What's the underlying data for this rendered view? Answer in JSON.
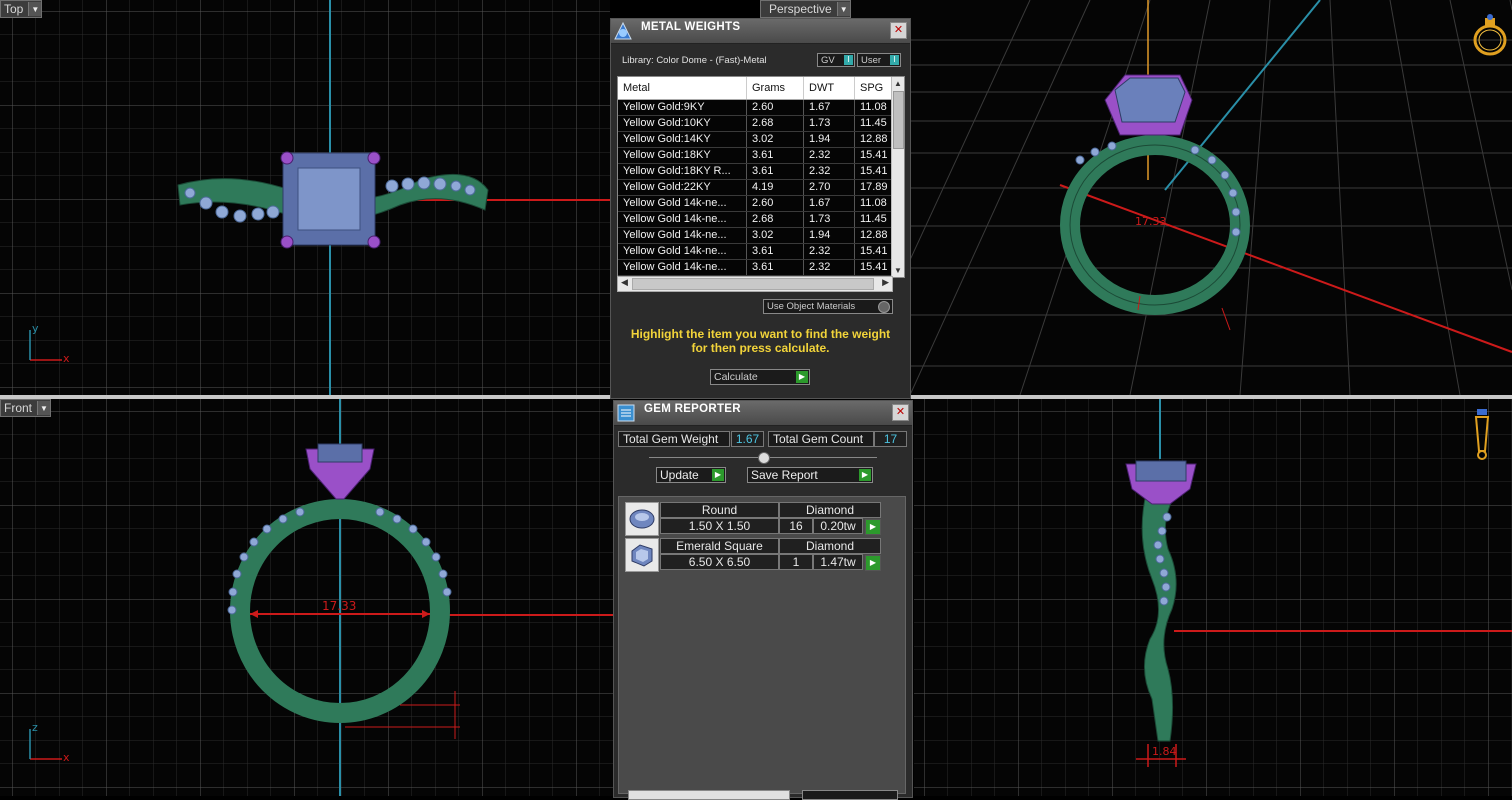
{
  "viewports": {
    "top": {
      "label": "Top",
      "axis_h": "x",
      "axis_v": "y"
    },
    "perspective": {
      "label": "Perspective"
    },
    "front": {
      "label": "Front",
      "axis_h": "x",
      "axis_v": "z",
      "dimension": "17.33"
    },
    "right": {
      "label": "",
      "dimension": "1.84"
    }
  },
  "metal_weights": {
    "title": "METAL WEIGHTS",
    "library": "Library: Color Dome - (Fast)-Metal",
    "toggle_gv": "GV",
    "toggle_user": "User",
    "columns": [
      "Metal",
      "Grams",
      "DWT",
      "SPG"
    ],
    "rows": [
      [
        "Yellow Gold:9KY",
        "2.60",
        "1.67",
        "11.08"
      ],
      [
        "Yellow Gold:10KY",
        "2.68",
        "1.73",
        "11.45"
      ],
      [
        "Yellow Gold:14KY",
        "3.02",
        "1.94",
        "12.88"
      ],
      [
        "Yellow Gold:18KY",
        "3.61",
        "2.32",
        "15.41"
      ],
      [
        "Yellow Gold:18KY R...",
        "3.61",
        "2.32",
        "15.41"
      ],
      [
        "Yellow Gold:22KY",
        "4.19",
        "2.70",
        "17.89"
      ],
      [
        "Yellow Gold 14k-ne...",
        "2.60",
        "1.67",
        "11.08"
      ],
      [
        "Yellow Gold 14k-ne...",
        "2.68",
        "1.73",
        "11.45"
      ],
      [
        "Yellow Gold 14k-ne...",
        "3.02",
        "1.94",
        "12.88"
      ],
      [
        "Yellow Gold 14k-ne...",
        "3.61",
        "2.32",
        "15.41"
      ],
      [
        "Yellow Gold 14k-ne...",
        "3.61",
        "2.32",
        "15.41"
      ]
    ],
    "use_object_materials": "Use Object Materials",
    "hint_line1": "Highlight the item you want to find the weight",
    "hint_line2": "for then press calculate.",
    "calculate": "Calculate"
  },
  "gem_reporter": {
    "title": "GEM REPORTER",
    "total_weight_label": "Total Gem Weight",
    "total_weight_value": "1.67",
    "total_count_label": "Total Gem Count",
    "total_count_value": "17",
    "update": "Update",
    "save_report": "Save Report",
    "gems": [
      {
        "icon": "round-gem-icon",
        "cut": "Round",
        "material": "Diamond",
        "size": "1.50 X 1.50",
        "count": "16",
        "weight": "0.20tw"
      },
      {
        "icon": "emerald-gem-icon",
        "cut": "Emerald Square",
        "material": "Diamond",
        "size": "6.50 X 6.50",
        "count": "1",
        "weight": "1.47tw"
      }
    ]
  },
  "colors": {
    "ring_metal": "#2f7a5a",
    "gem_blue": "#6f86bf",
    "prong_purple": "#9a50c8",
    "axis_red": "#cc1a1a",
    "axis_blue": "#2a8fa8",
    "hint_yellow": "#f2d43a"
  }
}
